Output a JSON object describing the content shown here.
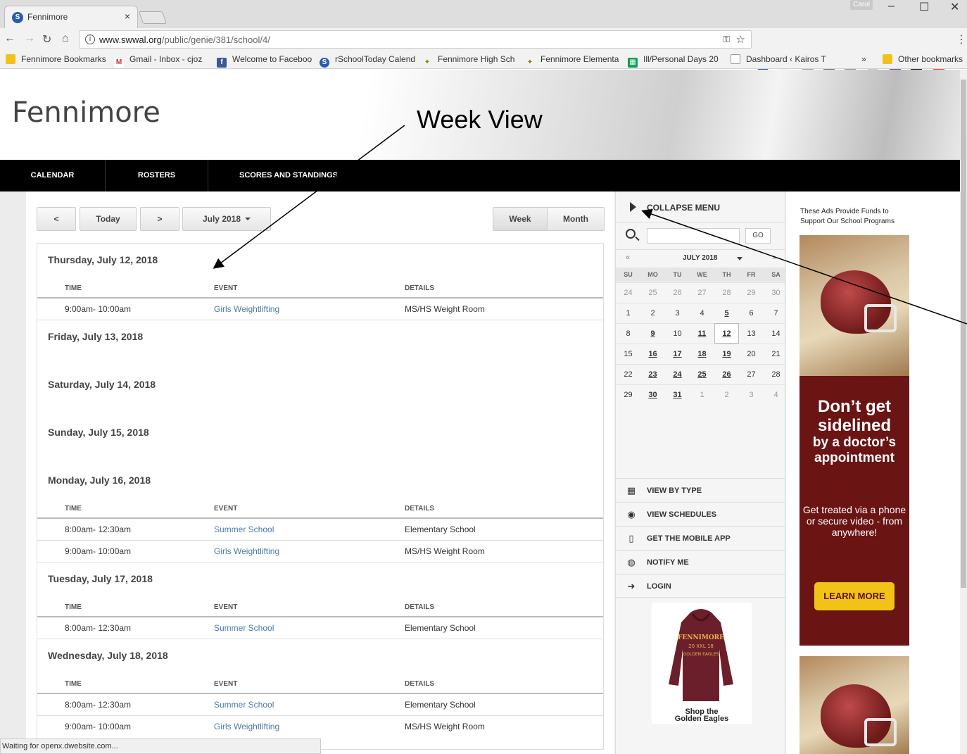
{
  "browser": {
    "tab_title": "Fennimore",
    "tab_close": "×",
    "profile": "Carol",
    "window_controls": [
      "–",
      "☐",
      "✕"
    ],
    "url_main": "www.swwal.org",
    "url_path": "/public/genie/381/school/4/",
    "status_text": "Waiting for openx.dwebsite.com...",
    "bookmarks": [
      {
        "label": "Fennimore Bookmarks",
        "icon": "folder-icon",
        "color": "#f2c218"
      },
      {
        "label": "Gmail - Inbox - cjoz",
        "icon": "gmail-icon",
        "color": "#d93025"
      },
      {
        "label": "Welcome to Faceboo",
        "icon": "facebook-icon",
        "color": "#3b5998"
      },
      {
        "label": "rSchoolToday Calend",
        "icon": "rschool-icon",
        "color": "#2a5da8"
      },
      {
        "label": "Fennimore High Sch",
        "icon": "eagle-icon",
        "color": "#8a7a00"
      },
      {
        "label": "Fennimore Elementa",
        "icon": "eagle-icon",
        "color": "#8a7a00"
      },
      {
        "label": "Ill/Personal Days 20",
        "icon": "sheets-icon",
        "color": "#0f9d58"
      },
      {
        "label": "Dashboard ‹ Kairos T",
        "icon": "page-icon",
        "color": "#999999"
      }
    ],
    "more_bookmarks": "»",
    "other_bookmarks": "Other bookmarks"
  },
  "site": {
    "title": "Fennimore",
    "annotation": "Week View",
    "nav": [
      "CALENDAR",
      "ROSTERS",
      "SCORES AND STANDINGS"
    ]
  },
  "controls": {
    "prev": "<",
    "today": "Today",
    "next": ">",
    "month_select": "July 2018",
    "week": "Week",
    "month": "Month"
  },
  "columns": {
    "time": "TIME",
    "event": "EVENT",
    "details": "DETAILS"
  },
  "days": [
    {
      "label": "Thursday, July 12, 2018",
      "events": [
        {
          "time": "9:00am- 10:00am",
          "event": "Girls Weightlifting",
          "details": "MS/HS Weight Room"
        }
      ]
    },
    {
      "label": "Friday, July 13, 2018",
      "events": []
    },
    {
      "label": "Saturday, July 14, 2018",
      "events": []
    },
    {
      "label": "Sunday, July 15, 2018",
      "events": []
    },
    {
      "label": "Monday, July 16, 2018",
      "events": [
        {
          "time": "8:00am- 12:30am",
          "event": "Summer School",
          "details": "Elementary School"
        },
        {
          "time": "9:00am- 10:00am",
          "event": "Girls Weightlifting",
          "details": "MS/HS Weight Room"
        }
      ]
    },
    {
      "label": "Tuesday, July 17, 2018",
      "events": [
        {
          "time": "8:00am- 12:30am",
          "event": "Summer School",
          "details": "Elementary School"
        }
      ]
    },
    {
      "label": "Wednesday, July 18, 2018",
      "events": [
        {
          "time": "8:00am- 12:30am",
          "event": "Summer School",
          "details": "Elementary School"
        },
        {
          "time": "9:00am- 10:00am",
          "event": "Girls Weightlifting",
          "details": "MS/HS Weight Room"
        }
      ]
    }
  ],
  "sidebar": {
    "collapse": "COLLAPSE MENU",
    "go": "GO",
    "cal_prev": "«",
    "cal_next": "»",
    "cal_month": "JULY 2018",
    "dow": [
      "SU",
      "MO",
      "TU",
      "WE",
      "TH",
      "FR",
      "SA"
    ],
    "weeks": [
      [
        "24",
        "25",
        "26",
        "27",
        "28",
        "29",
        "30"
      ],
      [
        "1",
        "2",
        "3",
        "4",
        "5",
        "6",
        "7"
      ],
      [
        "8",
        "9",
        "10",
        "11",
        "12",
        "13",
        "14"
      ],
      [
        "15",
        "16",
        "17",
        "18",
        "19",
        "20",
        "21"
      ],
      [
        "22",
        "23",
        "24",
        "25",
        "26",
        "27",
        "28"
      ],
      [
        "29",
        "30",
        "31",
        "1",
        "2",
        "3",
        "4"
      ]
    ],
    "selected_day": "12",
    "event_days": [
      "5",
      "9",
      "11",
      "12",
      "16",
      "17",
      "18",
      "19",
      "23",
      "24",
      "25",
      "26",
      "30",
      "31"
    ],
    "menu": [
      {
        "label": "VIEW BY TYPE",
        "icon": "calendar-icon"
      },
      {
        "label": "VIEW SCHEDULES",
        "icon": "eye-icon"
      },
      {
        "label": "GET THE MOBILE APP",
        "icon": "phone-icon"
      },
      {
        "label": "NOTIFY ME",
        "icon": "globe-icon"
      },
      {
        "label": "LOGIN",
        "icon": "login-icon"
      }
    ],
    "shop_line1": "Shop the",
    "shop_line2": "Golden Eagles",
    "hoodie_text1": "FENNIMORE",
    "hoodie_text2": "20 XXL 18",
    "hoodie_text3": "GOLDEN EAGLES"
  },
  "ads": {
    "title": "These Ads Provide Funds to Support Our School Programs",
    "headline1": "Don’t get sidelined",
    "headline2": "by a doctor’s appointment",
    "body": "Get treated via a phone or secure video - from anywhere!",
    "cta": "LEARN MORE"
  }
}
